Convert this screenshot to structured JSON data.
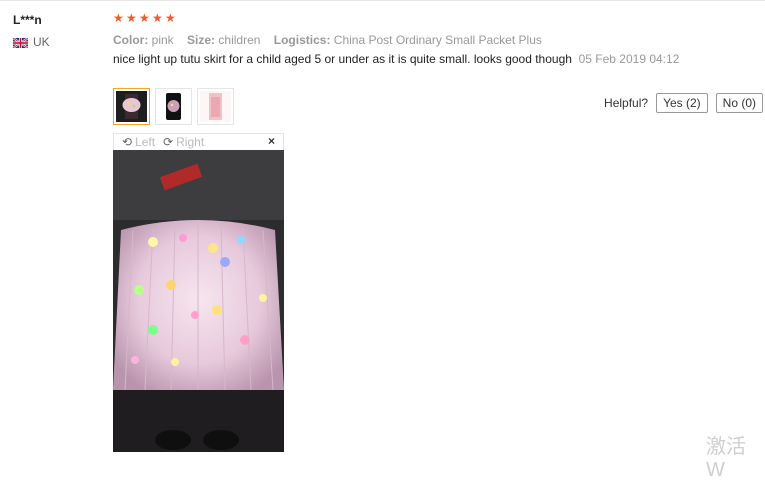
{
  "reviewer": {
    "name": "L***n",
    "country": "UK"
  },
  "review": {
    "rating": 5,
    "color_label": "Color:",
    "color_value": "pink",
    "size_label": "Size:",
    "size_value": "children",
    "logistics_label": "Logistics:",
    "logistics_value": "China Post Ordinary Small Packet Plus",
    "text": "nice light up tutu skirt for a child aged 5 or under as it is quite small. looks good though",
    "date": "05 Feb 2019 04:12"
  },
  "helpful": {
    "label": "Helpful?",
    "yes": "Yes (2)",
    "no": "No (0)"
  },
  "viewer": {
    "left": "Left",
    "right": "Right",
    "close": "×"
  },
  "watermark": "激活 W",
  "colors": {
    "stars": "#f15a2b",
    "thumb_active": "#f6a623"
  },
  "icons": [
    "uk-flag-icon",
    "star-icon",
    "rotate-left-icon",
    "rotate-right-icon",
    "close-icon"
  ]
}
